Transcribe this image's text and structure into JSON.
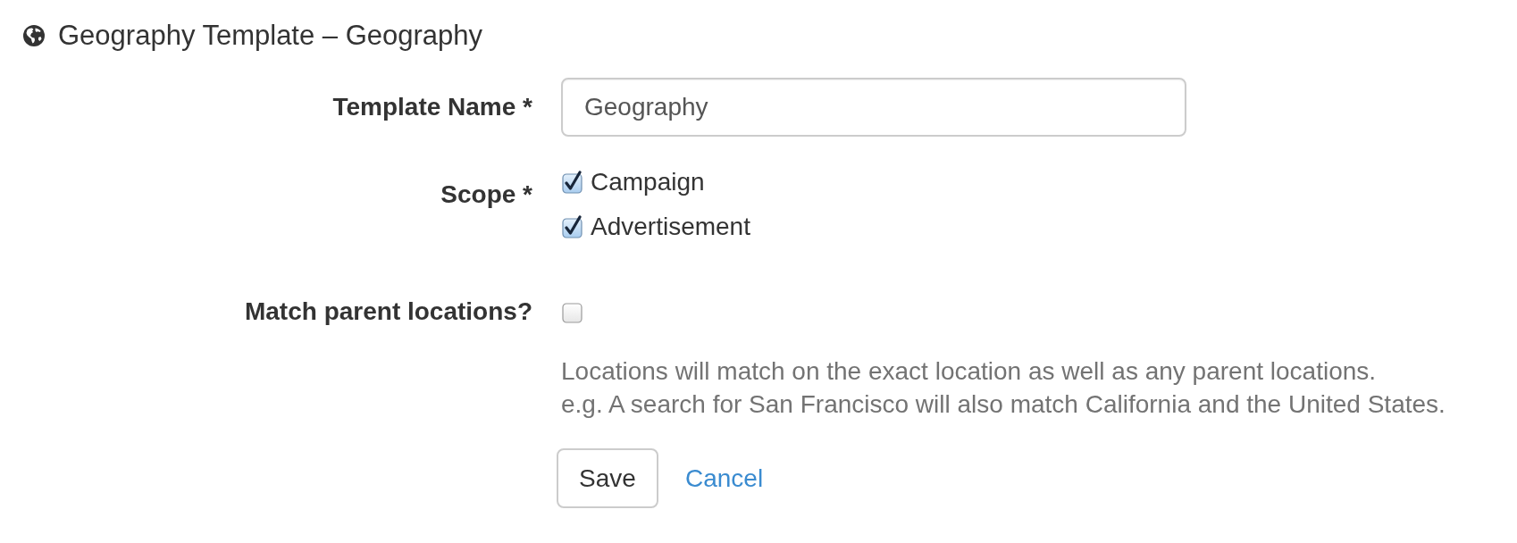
{
  "header": {
    "title": "Geography Template – Geography"
  },
  "form": {
    "fields": [
      {
        "kind": "text",
        "label": "Template Name *",
        "value": "Geography"
      },
      {
        "kind": "checkboxes",
        "label": "Scope *",
        "options": [
          {
            "label": "Campaign",
            "checked": true
          },
          {
            "label": "Advertisement",
            "checked": true
          }
        ]
      },
      {
        "kind": "checkbox",
        "label": "Match parent locations?",
        "checked": false,
        "help": [
          "Locations will match on the exact location as well as any parent locations.",
          "e.g. A search for San Francisco will also match California and the United States."
        ]
      }
    ]
  },
  "actions": {
    "buttons": [
      {
        "kind": "button",
        "label": "Save"
      },
      {
        "kind": "link",
        "label": "Cancel"
      }
    ]
  }
}
